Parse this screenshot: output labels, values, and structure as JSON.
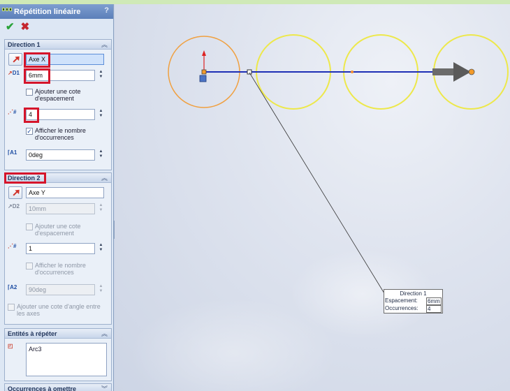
{
  "panel": {
    "title": "Répétition linéaire",
    "help_label": "?",
    "ok_label": "✔",
    "cancel_label": "✖"
  },
  "direction1": {
    "header": "Direction 1",
    "direction_value": "Axe X",
    "spacing_value": "6mm",
    "spacing_icon_label": "D1",
    "add_spacing_dim_label": "Ajouter une cote d'espacement",
    "add_spacing_dim_checked": false,
    "count_value": "4",
    "show_count_label": "Afficher le nombre d'occurrences",
    "show_count_checked": true,
    "angle_value": "0deg",
    "angle_icon_label": "A1"
  },
  "direction2": {
    "header": "Direction 2",
    "direction_value": "Axe Y",
    "spacing_value": "10mm",
    "spacing_icon_label": "D2",
    "add_spacing_dim_label": "Ajouter une cote d'espacement",
    "count_value": "1",
    "show_count_label": "Afficher le nombre d'occurrences",
    "angle_value": "90deg",
    "angle_icon_label": "A2",
    "add_angle_dim_label": "Ajouter une cote d'angle entre les axes"
  },
  "entities": {
    "header": "Entités à répéter",
    "items": [
      "Arc3"
    ]
  },
  "skip": {
    "header": "Occurrences à omettre"
  },
  "callout": {
    "title": "Direction 1",
    "spacing_label": "Espacement:",
    "spacing_value": "6mm",
    "count_label": "Occurrences:",
    "count_value": "4"
  },
  "colors": {
    "original_circle": "#f0a040",
    "preview_circle": "#ede84a",
    "direction_line": "#1e2fb5",
    "highlight": "#d5152b"
  }
}
